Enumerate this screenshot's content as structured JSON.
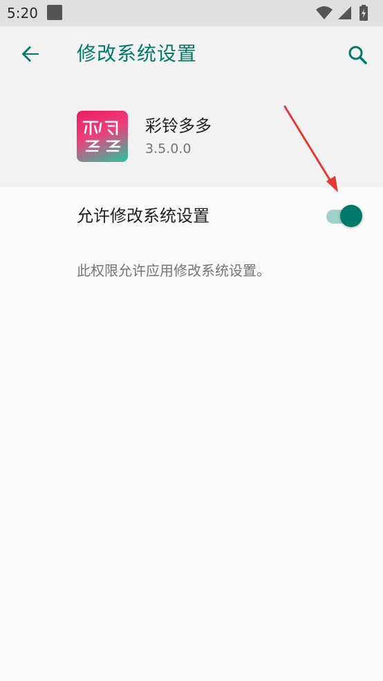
{
  "status_bar": {
    "time": "5:20",
    "icons": [
      "notification-app-icon",
      "wifi-icon",
      "signal-icon",
      "battery-charging-icon"
    ]
  },
  "app_bar": {
    "title": "修改系统设置",
    "back_icon": "arrow-back-icon",
    "search_icon": "search-icon"
  },
  "app": {
    "name": "彩铃多多",
    "version": "3.5.0.0",
    "icon": "app-logo-icon"
  },
  "setting": {
    "label": "允许修改系统设置",
    "enabled": true
  },
  "description": "此权限允许应用修改系统设置。",
  "colors": {
    "accent": "#00796b",
    "accent_track": "#9fd1cb",
    "status_bar": "#e0e0e0",
    "header_bg": "#f2f2f2",
    "page_bg": "#fafafa",
    "annotation_arrow": "#e53935"
  }
}
